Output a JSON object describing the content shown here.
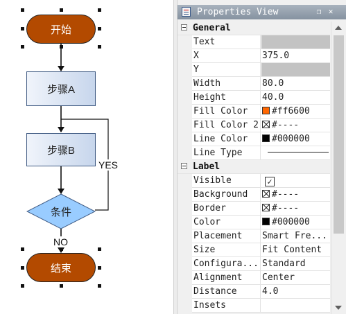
{
  "canvas": {
    "nodes": {
      "start": "开始",
      "step_a": "步骤A",
      "step_b": "步骤B",
      "condition": "条件",
      "end": "结束"
    },
    "edge_labels": {
      "yes": "YES",
      "no": "NO"
    },
    "colors": {
      "terminal_fill": "#b34a00",
      "step_fill_start": "#f0f4fb",
      "step_fill_end": "#c7d6ec",
      "decision_fill": "#99ccff"
    }
  },
  "panel": {
    "title": "Properties View",
    "title_buttons": [
      "restore-icon",
      "close-icon"
    ],
    "categories": [
      {
        "label": "General",
        "rows": [
          {
            "name": "Text",
            "value": "",
            "kind": "gray"
          },
          {
            "name": "X",
            "value": "375.0",
            "kind": "text"
          },
          {
            "name": "Y",
            "value": "",
            "kind": "gray"
          },
          {
            "name": "Width",
            "value": "80.0",
            "kind": "text"
          },
          {
            "name": "Height",
            "value": "40.0",
            "kind": "text"
          },
          {
            "name": "Fill Color",
            "value": "#ff6600",
            "kind": "color",
            "swatch": "#ff6600"
          },
          {
            "name": "Fill Color 2",
            "value": "#----",
            "kind": "nocolor"
          },
          {
            "name": "Line Color",
            "value": "#000000",
            "kind": "color",
            "swatch": "#000000"
          },
          {
            "name": "Line Type",
            "value": "",
            "kind": "line"
          }
        ]
      },
      {
        "label": "Label",
        "rows": [
          {
            "name": "Visible",
            "value": "✓",
            "kind": "check"
          },
          {
            "name": "Background",
            "value": "#----",
            "kind": "nocolor"
          },
          {
            "name": "Border",
            "value": "#----",
            "kind": "nocolor"
          },
          {
            "name": "Color",
            "value": "#000000",
            "kind": "color",
            "swatch": "#000000"
          },
          {
            "name": "Placement",
            "value": "Smart Fre...",
            "kind": "text"
          },
          {
            "name": "Size",
            "value": "Fit Content",
            "kind": "text"
          },
          {
            "name": "Configura...",
            "value": "Standard",
            "kind": "text"
          },
          {
            "name": "Alignment",
            "value": "Center",
            "kind": "text"
          },
          {
            "name": "Distance",
            "value": "4.0",
            "kind": "text"
          },
          {
            "name": "Insets",
            "value": "",
            "kind": "text"
          }
        ]
      }
    ]
  }
}
